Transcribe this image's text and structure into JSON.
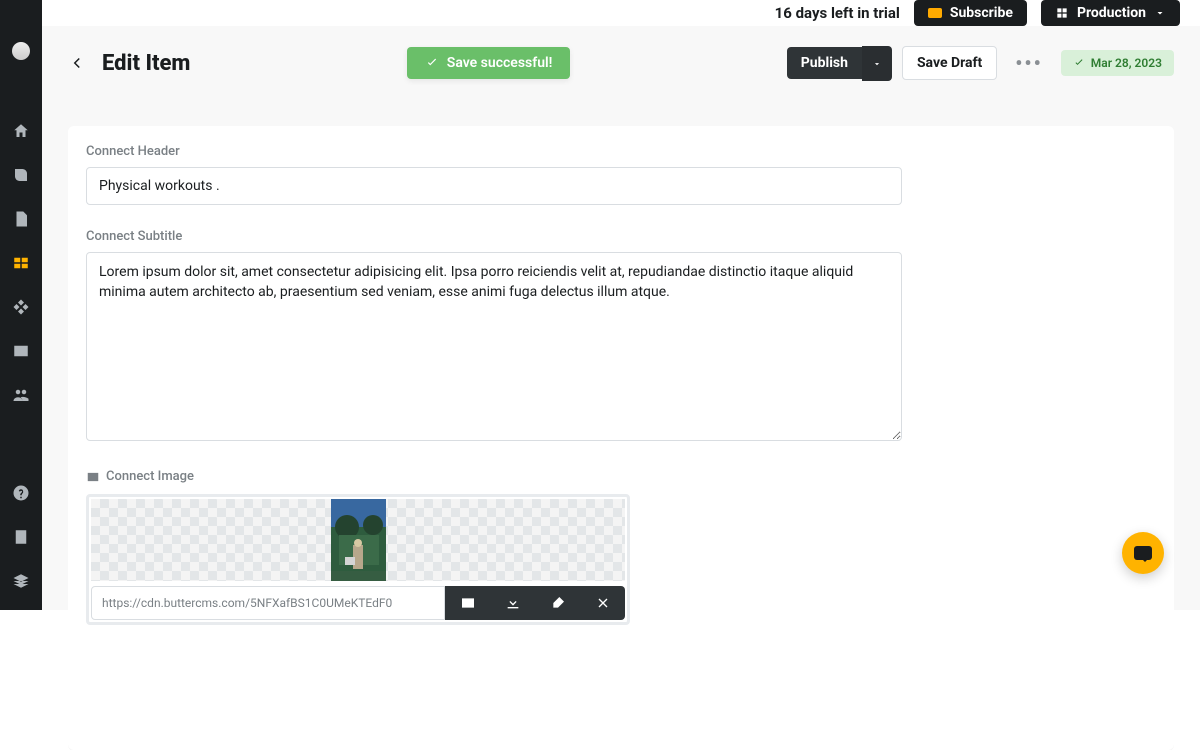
{
  "topbar": {
    "trial_text": "16 days left in trial",
    "subscribe_label": "Subscribe",
    "env_label": "Production"
  },
  "header": {
    "title": "Edit Item",
    "toast_text": "Save successful!",
    "publish_label": "Publish",
    "draft_label": "Save Draft",
    "status_date": "Mar 28, 2023"
  },
  "form": {
    "header_label": "Connect Header",
    "header_value": "Physical workouts .",
    "subtitle_label": "Connect Subtitle",
    "subtitle_value": "Lorem ipsum dolor sit, amet consectetur adipisicing elit. Ipsa porro reiciendis velit at, repudiandae distinctio itaque aliquid minima autem architecto ab, praesentium sed veniam, esse animi fuga delectus illum atque.",
    "image_label": "Connect Image",
    "image_url": "https://cdn.buttercms.com/5NFXafBS1C0UMeKTEdF0"
  }
}
